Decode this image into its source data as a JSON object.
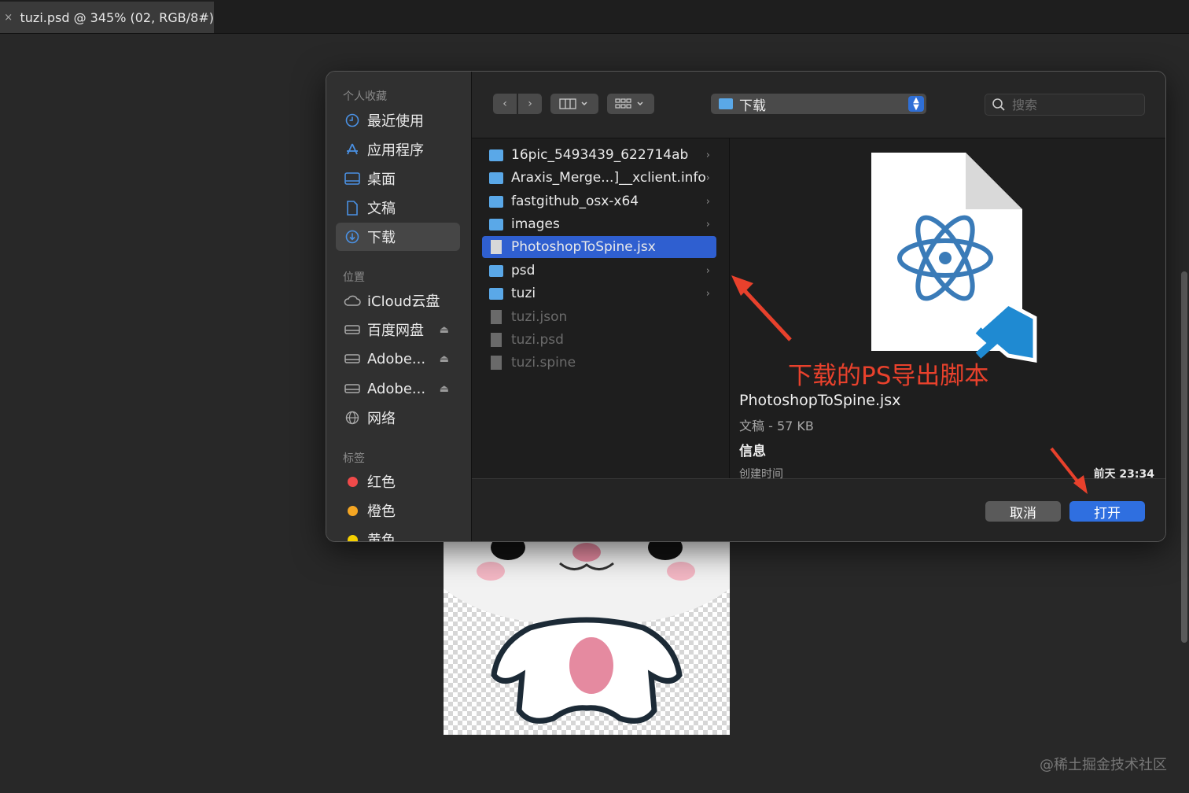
{
  "tab": {
    "close": "×",
    "title": "tuzi.psd @ 345% (02, RGB/8#)"
  },
  "watermark": "@稀土掘金技术社区",
  "sidebar": {
    "favorites_header": "个人收藏",
    "favorites": [
      {
        "label": "最近使用",
        "icon": "clock-icon"
      },
      {
        "label": "应用程序",
        "icon": "apps-icon"
      },
      {
        "label": "桌面",
        "icon": "desktop-icon"
      },
      {
        "label": "文稿",
        "icon": "document-icon"
      },
      {
        "label": "下载",
        "icon": "download-icon",
        "selected": true
      }
    ],
    "locations_header": "位置",
    "locations": [
      {
        "label": "iCloud云盘",
        "icon": "cloud-icon"
      },
      {
        "label": "百度网盘",
        "icon": "drive-icon",
        "eject": true
      },
      {
        "label": "Adobe...",
        "icon": "drive-icon",
        "eject": true
      },
      {
        "label": "Adobe...",
        "icon": "drive-icon",
        "eject": true
      },
      {
        "label": "网络",
        "icon": "network-icon"
      }
    ],
    "tags_header": "标签",
    "tags": [
      {
        "label": "红色",
        "color": "#f04a4a"
      },
      {
        "label": "橙色",
        "color": "#f5a623"
      },
      {
        "label": "黄色",
        "color": "#f5d000"
      }
    ]
  },
  "toolbar": {
    "back": "‹",
    "forward": "›",
    "location": "下载",
    "search_placeholder": "搜索"
  },
  "files": [
    {
      "name": "16pic_5493439_622714ab",
      "type": "folder",
      "chevron": true
    },
    {
      "name": "Araxis_Merge...]__xclient.info",
      "type": "folder",
      "chevron": true
    },
    {
      "name": "fastgithub_osx-x64",
      "type": "folder",
      "chevron": true
    },
    {
      "name": "images",
      "type": "folder",
      "chevron": true
    },
    {
      "name": "PhotoshopToSpine.jsx",
      "type": "doc",
      "selected": true
    },
    {
      "name": "psd",
      "type": "folder",
      "chevron": true
    },
    {
      "name": "tuzi",
      "type": "folder",
      "chevron": true
    },
    {
      "name": "tuzi.json",
      "type": "dim"
    },
    {
      "name": "tuzi.psd",
      "type": "dim"
    },
    {
      "name": "tuzi.spine",
      "type": "dim"
    }
  ],
  "preview": {
    "annotation": "下载的PS导出脚本",
    "name": "PhotoshopToSpine.jsx",
    "kind": "文稿 - 57 KB",
    "info": "信息",
    "created_label": "创建时间",
    "created_value": "前天 23:34"
  },
  "buttons": {
    "cancel": "取消",
    "open": "打开"
  },
  "colors": {
    "accent": "#2f6fe0",
    "annotation": "#e8412c"
  }
}
